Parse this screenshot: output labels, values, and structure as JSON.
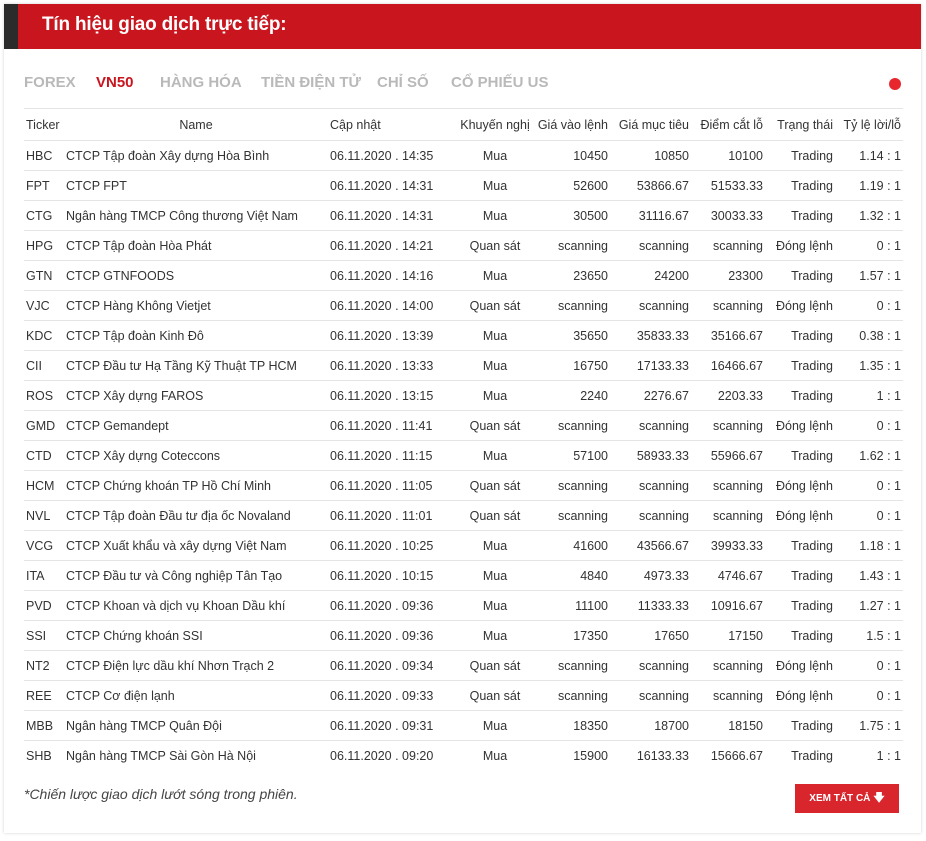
{
  "header": {
    "title": "Tín hiệu giao dịch trực tiếp:"
  },
  "tabs": [
    {
      "label": "FOREX"
    },
    {
      "label": "VN50"
    },
    {
      "label": "HÀNG HÓA"
    },
    {
      "label": "TIỀN ĐIỆN TỬ"
    },
    {
      "label": "CHỈ SỐ"
    },
    {
      "label": "CỔ PHIẾU US"
    }
  ],
  "active_tab": "VN50",
  "live_indicator_color": "#e8262e",
  "colors": {
    "brand_red": "#c9151e",
    "buy_green": "#1e9c3c",
    "watch_orange": "#ee7a1e"
  },
  "table": {
    "columns": {
      "ticker": "Ticker",
      "name": "Name",
      "updated": "Cập nhật",
      "recommendation": "Khuyến nghị",
      "entry": "Giá vào lệnh",
      "target": "Giá mục tiêu",
      "stop": "Điểm cắt lỗ",
      "status": "Trạng thái",
      "ratio": "Tỷ lệ lời/lỗ"
    },
    "rows": [
      {
        "ticker": "HBC",
        "name": "CTCP Tập đoàn Xây dựng Hòa Bình",
        "updated": "06.11.2020 . 14:35",
        "rec": "Mua",
        "rec_type": "buy",
        "entry": "10450",
        "target": "10850",
        "stop": "10100",
        "status": "Trading",
        "ratio": "1.14 : 1"
      },
      {
        "ticker": "FPT",
        "name": "CTCP FPT",
        "updated": "06.11.2020 . 14:31",
        "rec": "Mua",
        "rec_type": "buy",
        "entry": "52600",
        "target": "53866.67",
        "stop": "51533.33",
        "status": "Trading",
        "ratio": "1.19 : 1"
      },
      {
        "ticker": "CTG",
        "name": "Ngân hàng TMCP Công thương Việt Nam",
        "updated": "06.11.2020 . 14:31",
        "rec": "Mua",
        "rec_type": "buy",
        "entry": "30500",
        "target": "31116.67",
        "stop": "30033.33",
        "status": "Trading",
        "ratio": "1.32 : 1"
      },
      {
        "ticker": "HPG",
        "name": "CTCP Tập đoàn Hòa Phát",
        "updated": "06.11.2020 . 14:21",
        "rec": "Quan sát",
        "rec_type": "watch",
        "entry": "scanning",
        "target": "scanning",
        "stop": "scanning",
        "status": "Đóng lệnh",
        "ratio": "0 : 1"
      },
      {
        "ticker": "GTN",
        "name": "CTCP GTNFOODS",
        "updated": "06.11.2020 . 14:16",
        "rec": "Mua",
        "rec_type": "buy",
        "entry": "23650",
        "target": "24200",
        "stop": "23300",
        "status": "Trading",
        "ratio": "1.57 : 1"
      },
      {
        "ticker": "VJC",
        "name": "CTCP Hàng Không Vietjet",
        "updated": "06.11.2020 . 14:00",
        "rec": "Quan sát",
        "rec_type": "watch",
        "entry": "scanning",
        "target": "scanning",
        "stop": "scanning",
        "status": "Đóng lệnh",
        "ratio": "0 : 1"
      },
      {
        "ticker": "KDC",
        "name": "CTCP Tập đoàn Kinh Đô",
        "updated": "06.11.2020 . 13:39",
        "rec": "Mua",
        "rec_type": "buy",
        "entry": "35650",
        "target": "35833.33",
        "stop": "35166.67",
        "status": "Trading",
        "ratio": "0.38 : 1"
      },
      {
        "ticker": "CII",
        "name": "CTCP Đầu tư Hạ Tầng Kỹ Thuật TP HCM",
        "updated": "06.11.2020 . 13:33",
        "rec": "Mua",
        "rec_type": "buy",
        "entry": "16750",
        "target": "17133.33",
        "stop": "16466.67",
        "status": "Trading",
        "ratio": "1.35 : 1"
      },
      {
        "ticker": "ROS",
        "name": "CTCP Xây dựng FAROS",
        "updated": "06.11.2020 . 13:15",
        "rec": "Mua",
        "rec_type": "buy",
        "entry": "2240",
        "target": "2276.67",
        "stop": "2203.33",
        "status": "Trading",
        "ratio": "1 : 1"
      },
      {
        "ticker": "GMD",
        "name": "CTCP Gemandept",
        "updated": "06.11.2020 . 11:41",
        "rec": "Quan sát",
        "rec_type": "watch",
        "entry": "scanning",
        "target": "scanning",
        "stop": "scanning",
        "status": "Đóng lệnh",
        "ratio": "0 : 1"
      },
      {
        "ticker": "CTD",
        "name": "CTCP Xây dựng Coteccons",
        "updated": "06.11.2020 . 11:15",
        "rec": "Mua",
        "rec_type": "buy",
        "entry": "57100",
        "target": "58933.33",
        "stop": "55966.67",
        "status": "Trading",
        "ratio": "1.62 : 1"
      },
      {
        "ticker": "HCM",
        "name": "CTCP Chứng khoán TP Hồ Chí Minh",
        "updated": "06.11.2020 . 11:05",
        "rec": "Quan sát",
        "rec_type": "watch",
        "entry": "scanning",
        "target": "scanning",
        "stop": "scanning",
        "status": "Đóng lệnh",
        "ratio": "0 : 1"
      },
      {
        "ticker": "NVL",
        "name": "CTCP Tập đoàn Đầu tư địa ốc Novaland",
        "updated": "06.11.2020 . 11:01",
        "rec": "Quan sát",
        "rec_type": "watch",
        "entry": "scanning",
        "target": "scanning",
        "stop": "scanning",
        "status": "Đóng lệnh",
        "ratio": "0 : 1"
      },
      {
        "ticker": "VCG",
        "name": "CTCP Xuất khẩu và xây dựng Việt Nam",
        "updated": "06.11.2020 . 10:25",
        "rec": "Mua",
        "rec_type": "buy",
        "entry": "41600",
        "target": "43566.67",
        "stop": "39933.33",
        "status": "Trading",
        "ratio": "1.18 : 1"
      },
      {
        "ticker": "ITA",
        "name": "CTCP Đầu tư và Công nghiệp Tân Tạo",
        "updated": "06.11.2020 . 10:15",
        "rec": "Mua",
        "rec_type": "buy",
        "entry": "4840",
        "target": "4973.33",
        "stop": "4746.67",
        "status": "Trading",
        "ratio": "1.43 : 1"
      },
      {
        "ticker": "PVD",
        "name": "CTCP Khoan và dịch vụ Khoan Dầu khí",
        "updated": "06.11.2020 . 09:36",
        "rec": "Mua",
        "rec_type": "buy",
        "entry": "11100",
        "target": "11333.33",
        "stop": "10916.67",
        "status": "Trading",
        "ratio": "1.27 : 1"
      },
      {
        "ticker": "SSI",
        "name": "CTCP Chứng khoán SSI",
        "updated": "06.11.2020 . 09:36",
        "rec": "Mua",
        "rec_type": "buy",
        "entry": "17350",
        "target": "17650",
        "stop": "17150",
        "status": "Trading",
        "ratio": "1.5 : 1"
      },
      {
        "ticker": "NT2",
        "name": "CTCP Điện lực dầu khí Nhơn Trạch 2",
        "updated": "06.11.2020 . 09:34",
        "rec": "Quan sát",
        "rec_type": "watch",
        "entry": "scanning",
        "target": "scanning",
        "stop": "scanning",
        "status": "Đóng lệnh",
        "ratio": "0 : 1"
      },
      {
        "ticker": "REE",
        "name": "CTCP Cơ điện lạnh",
        "updated": "06.11.2020 . 09:33",
        "rec": "Quan sát",
        "rec_type": "watch",
        "entry": "scanning",
        "target": "scanning",
        "stop": "scanning",
        "status": "Đóng lệnh",
        "ratio": "0 : 1"
      },
      {
        "ticker": "MBB",
        "name": "Ngân hàng TMCP Quân Đội",
        "updated": "06.11.2020 . 09:31",
        "rec": "Mua",
        "rec_type": "buy",
        "entry": "18350",
        "target": "18700",
        "stop": "18150",
        "status": "Trading",
        "ratio": "1.75 : 1"
      },
      {
        "ticker": "SHB",
        "name": "Ngân hàng TMCP Sài Gòn Hà Nội",
        "updated": "06.11.2020 . 09:20",
        "rec": "Mua",
        "rec_type": "buy",
        "entry": "15900",
        "target": "16133.33",
        "stop": "15666.67",
        "status": "Trading",
        "ratio": "1 : 1"
      }
    ]
  },
  "footnote": "*Chiến lược giao dịch lướt sóng trong phiên.",
  "view_all_button": {
    "label": "XEM TẤT CẢ",
    "icon": "arrow-down-icon"
  }
}
